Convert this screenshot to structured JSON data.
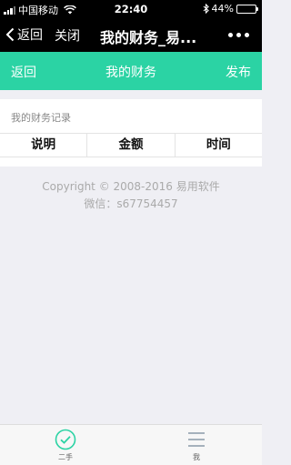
{
  "status_bar": {
    "carrier": "中国移动",
    "time": "22:40",
    "battery": "44%",
    "battery_level": 0.44
  },
  "wechat_nav": {
    "back_label": "返回",
    "close_label": "关闭",
    "title": "我的财务_易..."
  },
  "header": {
    "back_label": "返回",
    "title": "我的财务",
    "publish_label": "发布",
    "color": "#2bd3a4"
  },
  "records": {
    "section_label": "我的财务记录",
    "columns": [
      "说明",
      "金额",
      "时间"
    ]
  },
  "footer": {
    "copyright": "Copyright © 2008-2016 易用软件",
    "wechat": "微信：s67754457"
  },
  "tabbar": {
    "items": [
      {
        "label": "二手",
        "icon": "check-circle-icon"
      },
      {
        "label": "我",
        "icon": "menu-icon"
      }
    ]
  }
}
